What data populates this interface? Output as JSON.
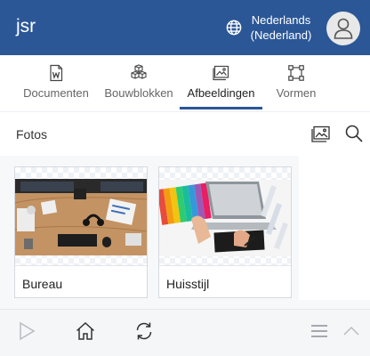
{
  "header": {
    "brand": "jsr",
    "language_line1": "Nederlands",
    "language_line2": "(Nederland)",
    "accent_color": "#2b5797"
  },
  "tabs": [
    {
      "label": "Documenten",
      "icon": "word-document-icon",
      "active": false
    },
    {
      "label": "Bouwblokken",
      "icon": "cubes-icon",
      "active": false
    },
    {
      "label": "Afbeeldingen",
      "icon": "image-icon",
      "active": true
    },
    {
      "label": "Vormen",
      "icon": "shape-icon",
      "active": false
    }
  ],
  "subbar": {
    "title": "Fotos",
    "icons": [
      "image-icon",
      "search-icon"
    ]
  },
  "cards": [
    {
      "label": "Bureau"
    },
    {
      "label": "Huisstijl"
    }
  ],
  "footer": {
    "icons": [
      "play-icon",
      "home-icon",
      "refresh-icon",
      "menu-icon",
      "chevron-up-icon"
    ]
  }
}
